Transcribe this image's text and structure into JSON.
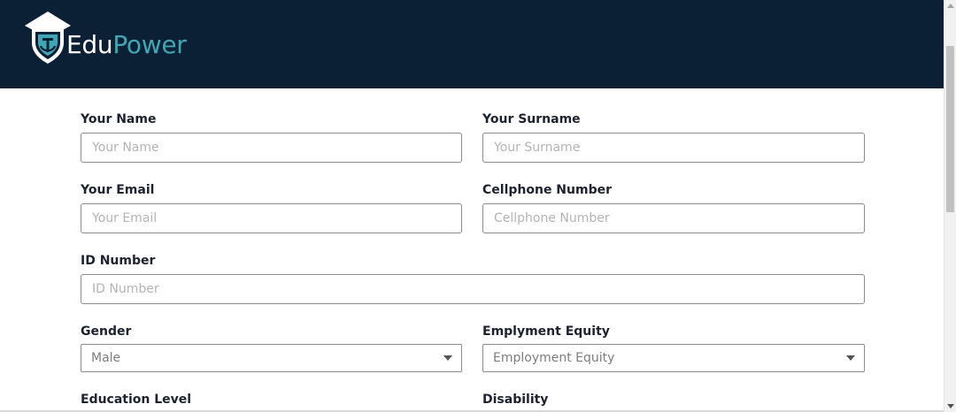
{
  "brand": {
    "part1": "Edu",
    "part2": "Power"
  },
  "colors": {
    "header_bg": "#0b2035",
    "brand_accent": "#3fa7b4",
    "label": "#1d2230"
  },
  "form": {
    "name": {
      "label": "Your Name",
      "placeholder": "Your Name"
    },
    "surname": {
      "label": "Your Surname",
      "placeholder": "Your Surname"
    },
    "email": {
      "label": "Your Email",
      "placeholder": "Your Email"
    },
    "cellphone": {
      "label": "Cellphone Number",
      "placeholder": "Cellphone Number"
    },
    "id_number": {
      "label": "ID Number",
      "placeholder": "ID Number"
    },
    "gender": {
      "label": "Gender",
      "value": "Male"
    },
    "equity": {
      "label": "Emplyment Equity",
      "value": "Employment Equity"
    },
    "education": {
      "label": "Education Level"
    },
    "disability": {
      "label": "Disability"
    }
  },
  "icons": {
    "logo": "shield-graduation-cap-icon",
    "dropdown": "caret-down-icon"
  }
}
